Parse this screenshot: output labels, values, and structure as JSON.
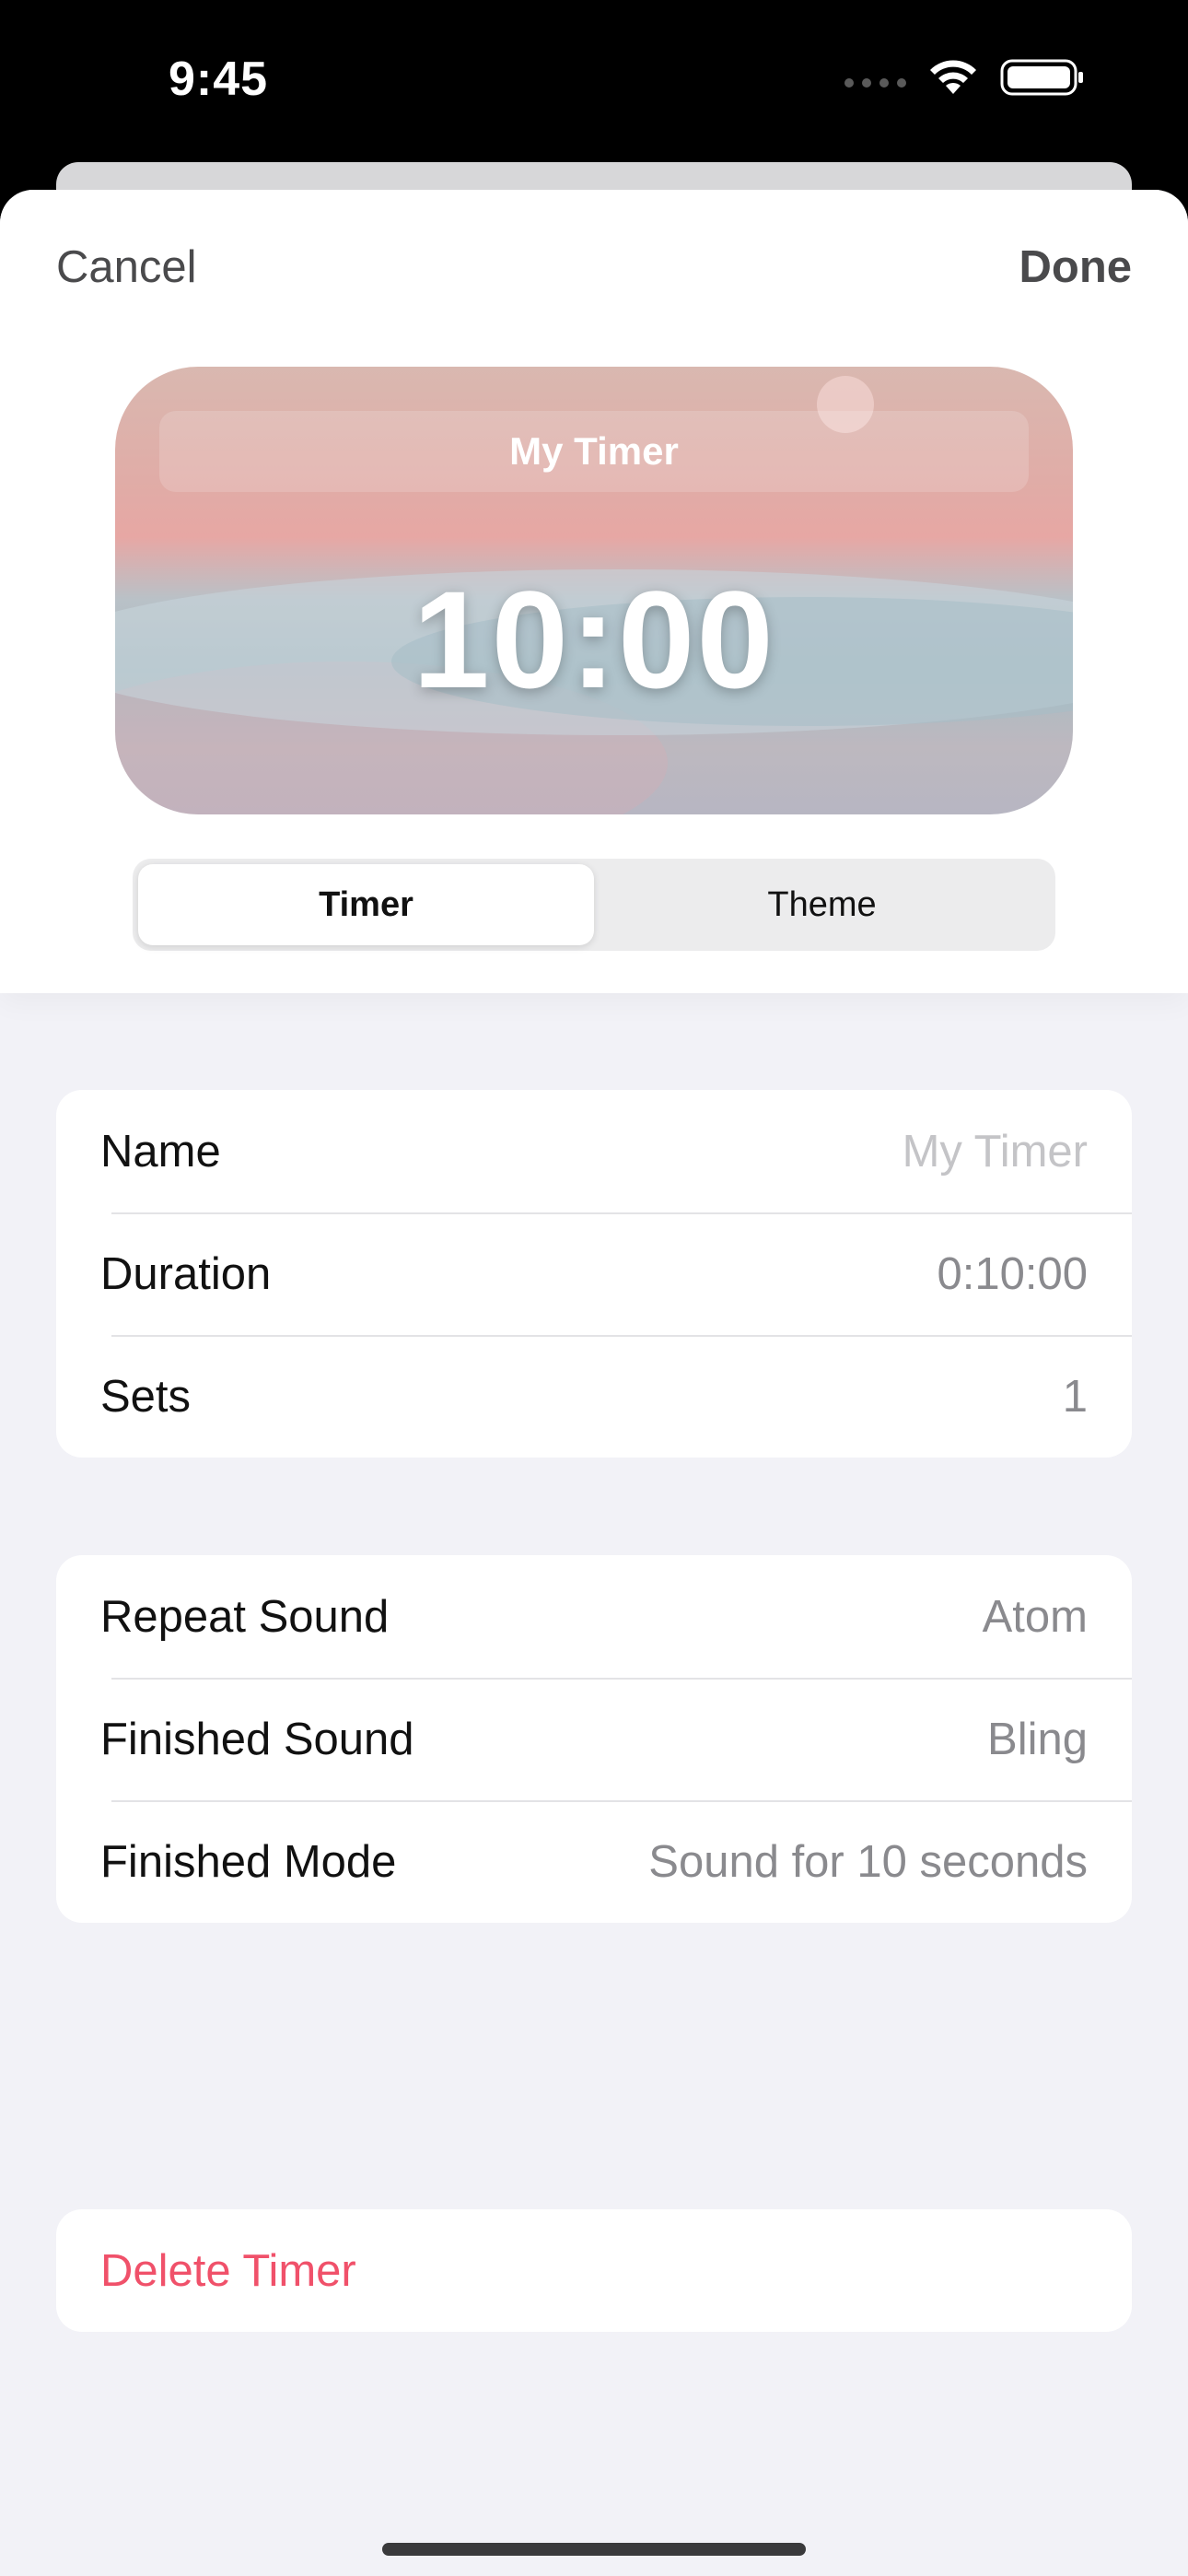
{
  "status_bar": {
    "time": "9:45",
    "signal_icon": "signal-dots-icon",
    "wifi_icon": "wifi-icon",
    "battery_icon": "battery-icon"
  },
  "nav": {
    "cancel_label": "Cancel",
    "done_label": "Done"
  },
  "preview": {
    "name": "My Timer",
    "time": "10:00"
  },
  "segments": {
    "timer_label": "Timer",
    "theme_label": "Theme",
    "selected": "Timer"
  },
  "timer_settings": {
    "name_label": "Name",
    "name_placeholder": "My Timer",
    "duration_label": "Duration",
    "duration_value": "0:10:00",
    "sets_label": "Sets",
    "sets_value": "1"
  },
  "sound_settings": {
    "repeat_label": "Repeat Sound",
    "repeat_value": "Atom",
    "finished_sound_label": "Finished Sound",
    "finished_sound_value": "Bling",
    "finished_mode_label": "Finished Mode",
    "finished_mode_value": "Sound for 10 seconds"
  },
  "delete_label": "Delete Timer",
  "colors": {
    "destructive": "#f0516a",
    "secondary_text": "#8a8a8e",
    "background": "#f2f2f7"
  }
}
